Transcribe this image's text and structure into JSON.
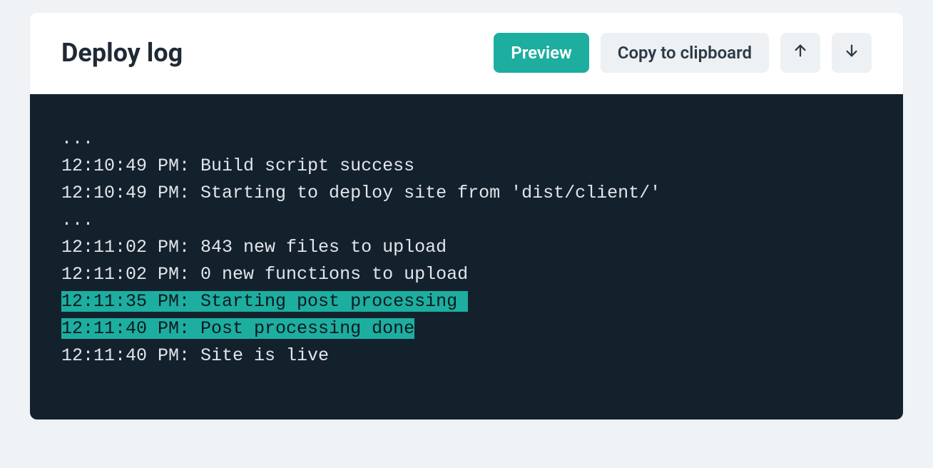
{
  "header": {
    "title": "Deploy log",
    "preview_label": "Preview",
    "copy_label": "Copy to clipboard"
  },
  "log": {
    "lines": [
      {
        "text": "...",
        "highlight": false
      },
      {
        "text": "12:10:49 PM: Build script success",
        "highlight": false
      },
      {
        "text": "12:10:49 PM: Starting to deploy site from 'dist/client/'",
        "highlight": false
      },
      {
        "text": "...",
        "highlight": false
      },
      {
        "text": "12:11:02 PM: 843 new files to upload",
        "highlight": false
      },
      {
        "text": "12:11:02 PM: 0 new functions to upload",
        "highlight": false
      },
      {
        "text": "12:11:35 PM: Starting post processing ",
        "highlight": true
      },
      {
        "text": "12:11:40 PM: Post processing done",
        "highlight": true
      },
      {
        "text": "12:11:40 PM: Site is live",
        "highlight": false
      }
    ]
  }
}
